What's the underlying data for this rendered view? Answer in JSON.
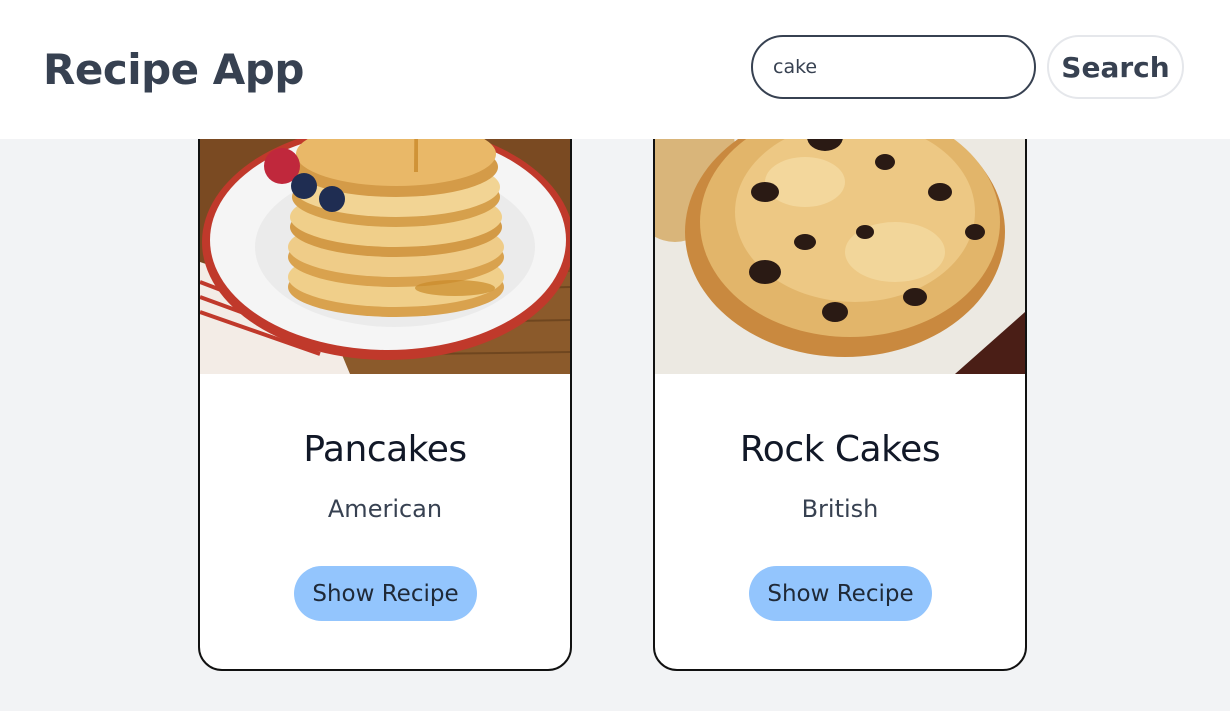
{
  "header": {
    "title": "Recipe App",
    "search_value": "cake",
    "search_button_label": "Search"
  },
  "recipes": [
    {
      "name": "Pancakes",
      "cuisine": "American",
      "button_label": "Show Recipe"
    },
    {
      "name": "Rock Cakes",
      "cuisine": "British",
      "button_label": "Show Recipe"
    }
  ],
  "colors": {
    "page_bg": "#f2f3f5",
    "header_bg": "#ffffff",
    "text_primary": "#374151",
    "button_accent": "#93c5fd"
  }
}
